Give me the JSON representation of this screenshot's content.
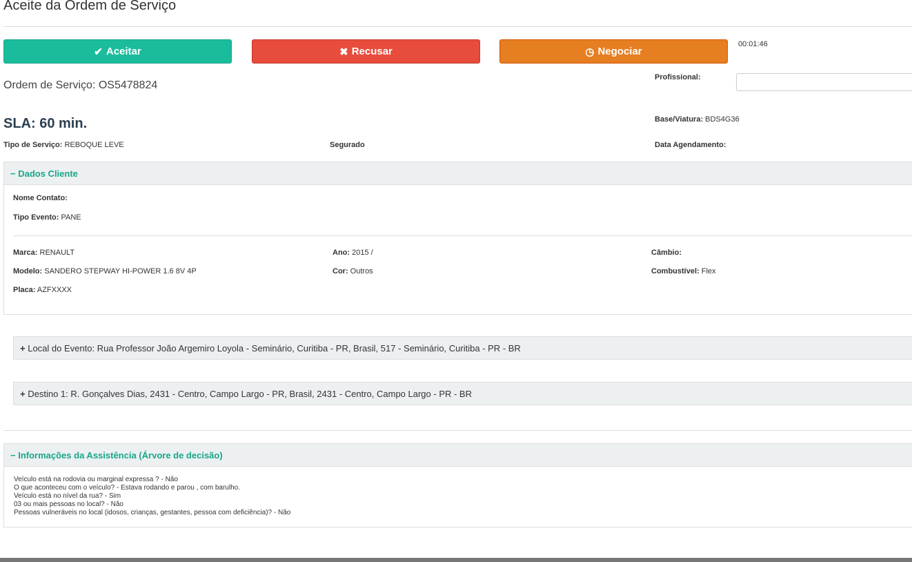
{
  "title": "Aceite da Ordem de Serviço",
  "buttons": {
    "accept": "Aceitar",
    "refuse": "Recusar",
    "negotiate": "Negociar"
  },
  "timer": "00:01:46",
  "order": "Ordem de Serviço: OS5478824",
  "sla": "SLA: 60 min.",
  "profissional": {
    "label": "Profissional:",
    "value": ""
  },
  "base": {
    "label": "Base/Viatura:",
    "value": "BDS4G36"
  },
  "tipo_servico": {
    "label": "Tipo de Serviço:",
    "value": "REBOQUE LEVE"
  },
  "segurado": {
    "label": "Segurado"
  },
  "data_agendamento": {
    "label": "Data Agendamento:"
  },
  "dados_cliente": {
    "title": "Dados Cliente",
    "nome_contato": {
      "label": "Nome Contato:",
      "value": ""
    },
    "tipo_evento": {
      "label": "Tipo Evento:",
      "value": "PANE"
    },
    "marca": {
      "label": "Marca:",
      "value": "RENAULT"
    },
    "modelo": {
      "label": "Modelo:",
      "value": "SANDERO STEPWAY HI-POWER 1.6 8V 4P"
    },
    "placa": {
      "label": "Placa:",
      "value": "AZFXXXX"
    },
    "ano": {
      "label": "Ano:",
      "value": "2015 /"
    },
    "cor": {
      "label": "Cor:",
      "value": "Outros"
    },
    "cambio": {
      "label": "Câmbio:",
      "value": ""
    },
    "combustivel": {
      "label": "Combustível:",
      "value": "Flex"
    }
  },
  "local_evento": "Local do Evento: Rua Professor João Argemiro Loyola - Seminário, Curitiba - PR, Brasil, 517 - Seminário, Curitiba - PR - BR",
  "destino": "Destino 1: R. Gonçalves Dias, 2431 - Centro, Campo Largo - PR, Brasil, 2431 - Centro, Campo Largo - PR - BR",
  "assistencia": {
    "title": "Informações da Assistência (Árvore de decisão)",
    "lines": [
      "Veículo está na rodovia ou marginal expressa ? - Não",
      "O que aconteceu com o veículo? - Estava rodando e parou , com barulho.",
      "Veículo está no nível da rua? - Sim",
      "03 ou mais pessoas no local? - Não",
      "Pessoas vulneráveis no local (idosos, crianças, gestantes, pessoa com deficiência)? - Não"
    ]
  },
  "colors": {
    "accept": "#1abc9c",
    "refuse": "#e74c3c",
    "negotiate": "#e67e22",
    "accent": "#18a689"
  }
}
